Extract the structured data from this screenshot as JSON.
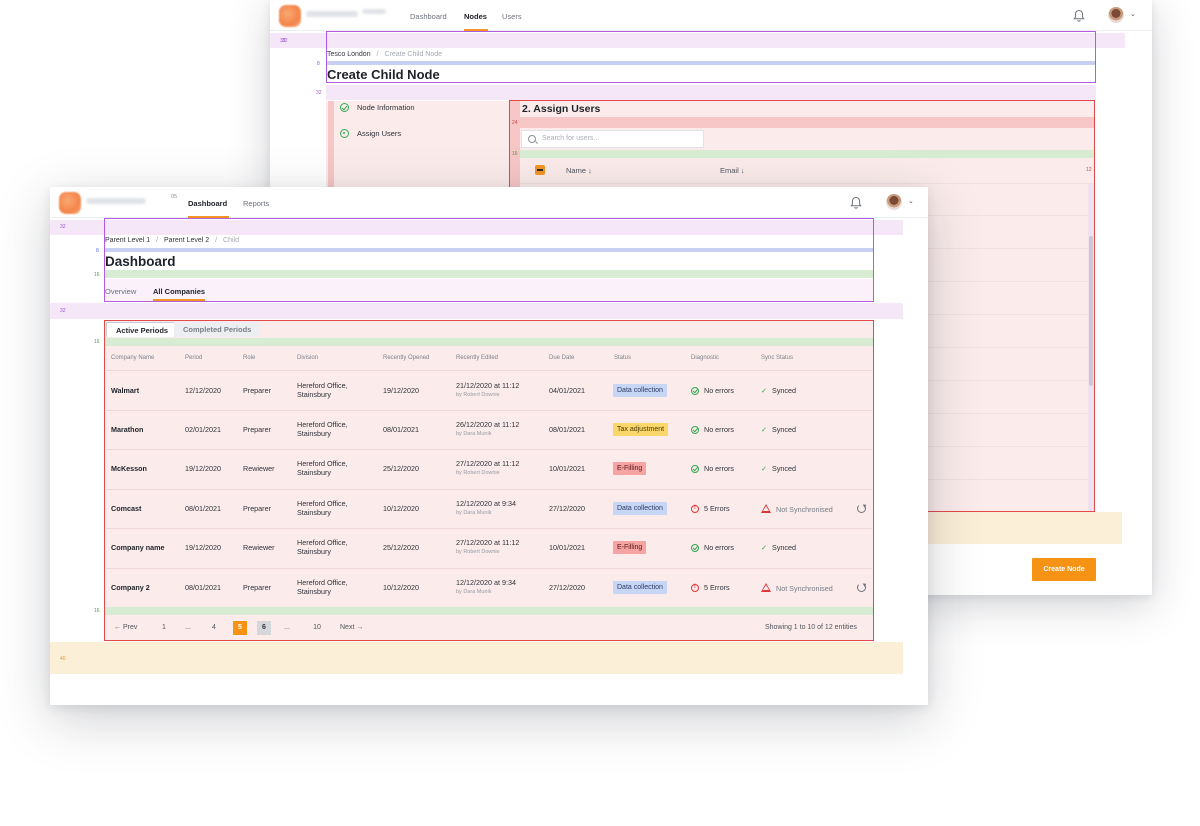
{
  "back_window": {
    "nav": [
      "Dashboard",
      "Nodes",
      "Users"
    ],
    "active_nav": "Nodes",
    "spacing": {
      "top": "32",
      "crumb_gap": "8",
      "title_gap": "32",
      "section_gap": "24",
      "search_gap": "16",
      "right": "12"
    },
    "breadcrumb": {
      "parent": "Tesco London",
      "separator": "/",
      "current": "Create Child Node"
    },
    "title": "Create Child Node",
    "steps": [
      {
        "label": "Node Information",
        "state": "done"
      },
      {
        "label": "Assign Users",
        "state": "current"
      }
    ],
    "section_title": "2. Assign Users",
    "search_placeholder": "Search for users...",
    "columns": [
      "Name ↓",
      "Email ↓"
    ],
    "create_button": "Create Node"
  },
  "front_window": {
    "nav": [
      "Dashboard",
      "Reports"
    ],
    "active_nav": "Dashboard",
    "logo_suffix": "05",
    "spacing": {
      "top": "32",
      "crumb_gap": "8",
      "title_gap": "16",
      "tabs_gap": "32",
      "table_top": "16",
      "table_bottom": "16",
      "footer": "40"
    },
    "breadcrumb": {
      "level1": "Parent Level 1",
      "level2": "Parent Level 2",
      "separator": "/",
      "current": "Child"
    },
    "title": "Dashboard",
    "tabs": [
      "Overview",
      "All Companies"
    ],
    "active_tab": "All Companies",
    "period_tabs": [
      "Active Periods",
      "Completed Periods"
    ],
    "table": {
      "headers": [
        "Company Name",
        "Period",
        "Role",
        "Division",
        "Recently Opened",
        "Recently Edited",
        "Due Date",
        "Status",
        "Diagnostic",
        "Sync Status"
      ],
      "rows": [
        {
          "company": "Walmart",
          "period": "12/12/2020",
          "role": "Preparer",
          "division": "Hereford Office,\nStainsbury",
          "opened": "19/12/2020",
          "edited": "21/12/2020 at 11:12",
          "edited_by": "by Robert Downie",
          "due": "04/01/2021",
          "status": "Data collection",
          "status_kind": "blue",
          "diagnostic": "No errors",
          "diag_kind": "ok",
          "sync": "Synced",
          "sync_kind": "ok"
        },
        {
          "company": "Marathon",
          "period": "02/01/2021",
          "role": "Preparer",
          "division": "Hereford Office,\nStainsbury",
          "opened": "08/01/2021",
          "edited": "26/12/2020 at 11:12",
          "edited_by": "by Dara Munik",
          "due": "08/01/2021",
          "status": "Tax adjustment",
          "status_kind": "yellow",
          "diagnostic": "No errors",
          "diag_kind": "ok",
          "sync": "Synced",
          "sync_kind": "ok"
        },
        {
          "company": "McKesson",
          "period": "19/12/2020",
          "role": "Rewiewer",
          "division": "Hereford Office,\nStainsbury",
          "opened": "25/12/2020",
          "edited": "27/12/2020 at 11:12",
          "edited_by": "by Robert Downie",
          "due": "10/01/2021",
          "status": "E-Filling",
          "status_kind": "red",
          "diagnostic": "No errors",
          "diag_kind": "ok",
          "sync": "Synced",
          "sync_kind": "ok"
        },
        {
          "company": "Comcast",
          "period": "08/01/2021",
          "role": "Preparer",
          "division": "Hereford Office,\nStainsbury",
          "opened": "10/12/2020",
          "edited": "12/12/2020 at 9:34",
          "edited_by": "by Dara Munik",
          "due": "27/12/2020",
          "status": "Data collection",
          "status_kind": "blue",
          "diagnostic": "5 Errors",
          "diag_kind": "err",
          "sync": "Not Synchronised",
          "sync_kind": "warn"
        },
        {
          "company": "Company name",
          "period": "19/12/2020",
          "role": "Rewiewer",
          "division": "Hereford Office,\nStainsbury",
          "opened": "25/12/2020",
          "edited": "27/12/2020 at 11:12",
          "edited_by": "by Robert Downie",
          "due": "10/01/2021",
          "status": "E-Filling",
          "status_kind": "red",
          "diagnostic": "No errors",
          "diag_kind": "ok",
          "sync": "Synced",
          "sync_kind": "ok"
        },
        {
          "company": "Company 2",
          "period": "08/01/2021",
          "role": "Preparer",
          "division": "Hereford Office,\nStainsbury",
          "opened": "10/12/2020",
          "edited": "12/12/2020 at 9:34",
          "edited_by": "by Dara Munik",
          "due": "27/12/2020",
          "status": "Data collection",
          "status_kind": "blue",
          "diagnostic": "5 Errors",
          "diag_kind": "err",
          "sync": "Not Synchronised",
          "sync_kind": "warn"
        }
      ]
    },
    "pagination": {
      "prev": "← Prev",
      "pages": [
        "1",
        "...",
        "4",
        "5",
        "6",
        "...",
        "10"
      ],
      "current": "5",
      "next": "Next →",
      "summary": "Showing 1 to 10 of 12 entities"
    }
  },
  "colors": {
    "accent": "#f79314",
    "status_blue": "#c8d6f5",
    "status_yellow": "#fbd66a",
    "status_red": "#f5a3a3",
    "ok_green": "#36a852",
    "error_red": "#e0383a"
  },
  "icons": [
    "bell-icon",
    "avatar",
    "chevron-down-icon",
    "search-icon",
    "check-circle-icon",
    "error-circle-icon",
    "warning-icon",
    "resync-icon"
  ]
}
